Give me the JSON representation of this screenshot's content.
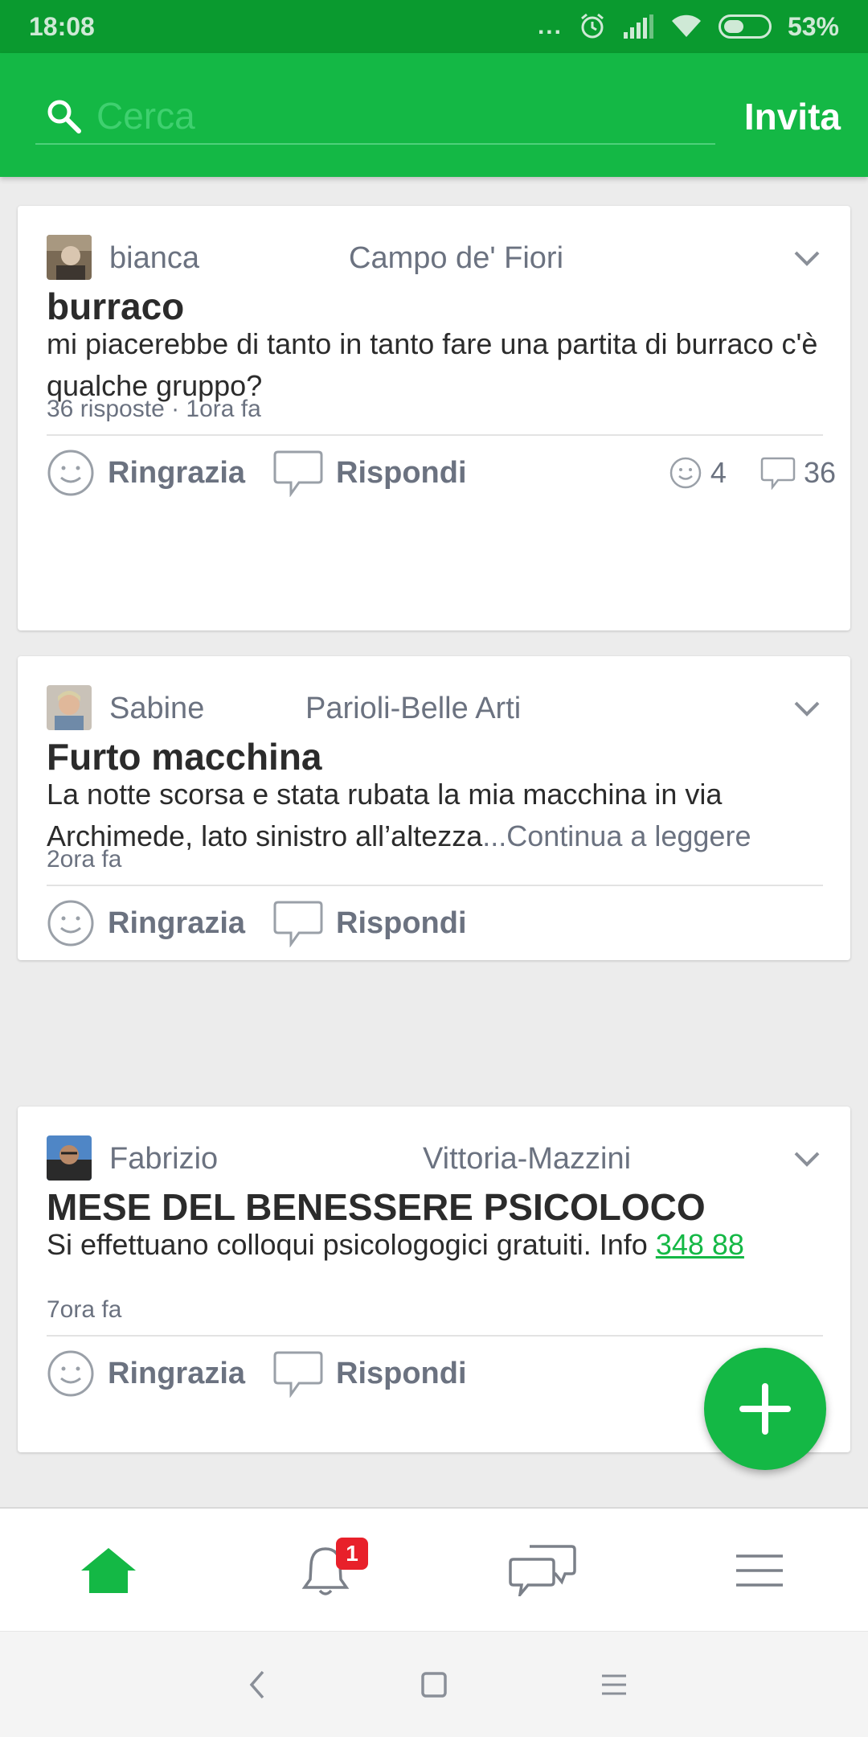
{
  "status_bar": {
    "time": "18:08",
    "dots": "...",
    "battery_percent": "53%"
  },
  "header": {
    "search_placeholder": "Cerca",
    "invite_label": "Invita"
  },
  "posts": [
    {
      "author": "bianca",
      "area": "Campo de' Fiori",
      "title": "burraco",
      "body": "mi piacerebbe di tanto in tanto fare una partita di burraco c'è qualche gruppo?",
      "meta": "36 risposte · 1ora fa",
      "thanks_label": "Ringrazia",
      "reply_label": "Rispondi",
      "thanks_count": "4",
      "reply_count": "36"
    },
    {
      "author": "Sabine",
      "area": "Parioli-Belle Arti",
      "title": "Furto macchina",
      "body": "La notte scorsa e stata rubata la mia macchina in via Archimede, lato sinistro all’altezza",
      "body_more": "...Continua a leggere",
      "meta": "2ora fa",
      "thanks_label": "Ringrazia",
      "reply_label": "Rispondi"
    },
    {
      "author": "Fabrizio",
      "area": "Vittoria-Mazzini",
      "title": "MESE DEL BENESSERE PSICOLOCO",
      "body": "Si effettuano colloqui psicologogici gratuiti. Info ",
      "body_link": "348 88",
      "meta": "7ora fa",
      "thanks_label": "Ringrazia",
      "reply_label": "Rispondi"
    }
  ],
  "bottom_nav": {
    "notifications_badge": "1"
  },
  "icons": [
    "search-icon",
    "chevron-down-icon",
    "smile-icon",
    "speech-bubble-icon",
    "plus-icon",
    "home-icon",
    "bell-icon",
    "chat-icon",
    "menu-icon",
    "back-icon",
    "square-icon"
  ],
  "colors": {
    "primary": "#14b845",
    "status_bar": "#0a9a2f",
    "badge": "#e8202a",
    "muted_text": "#6b7280"
  }
}
